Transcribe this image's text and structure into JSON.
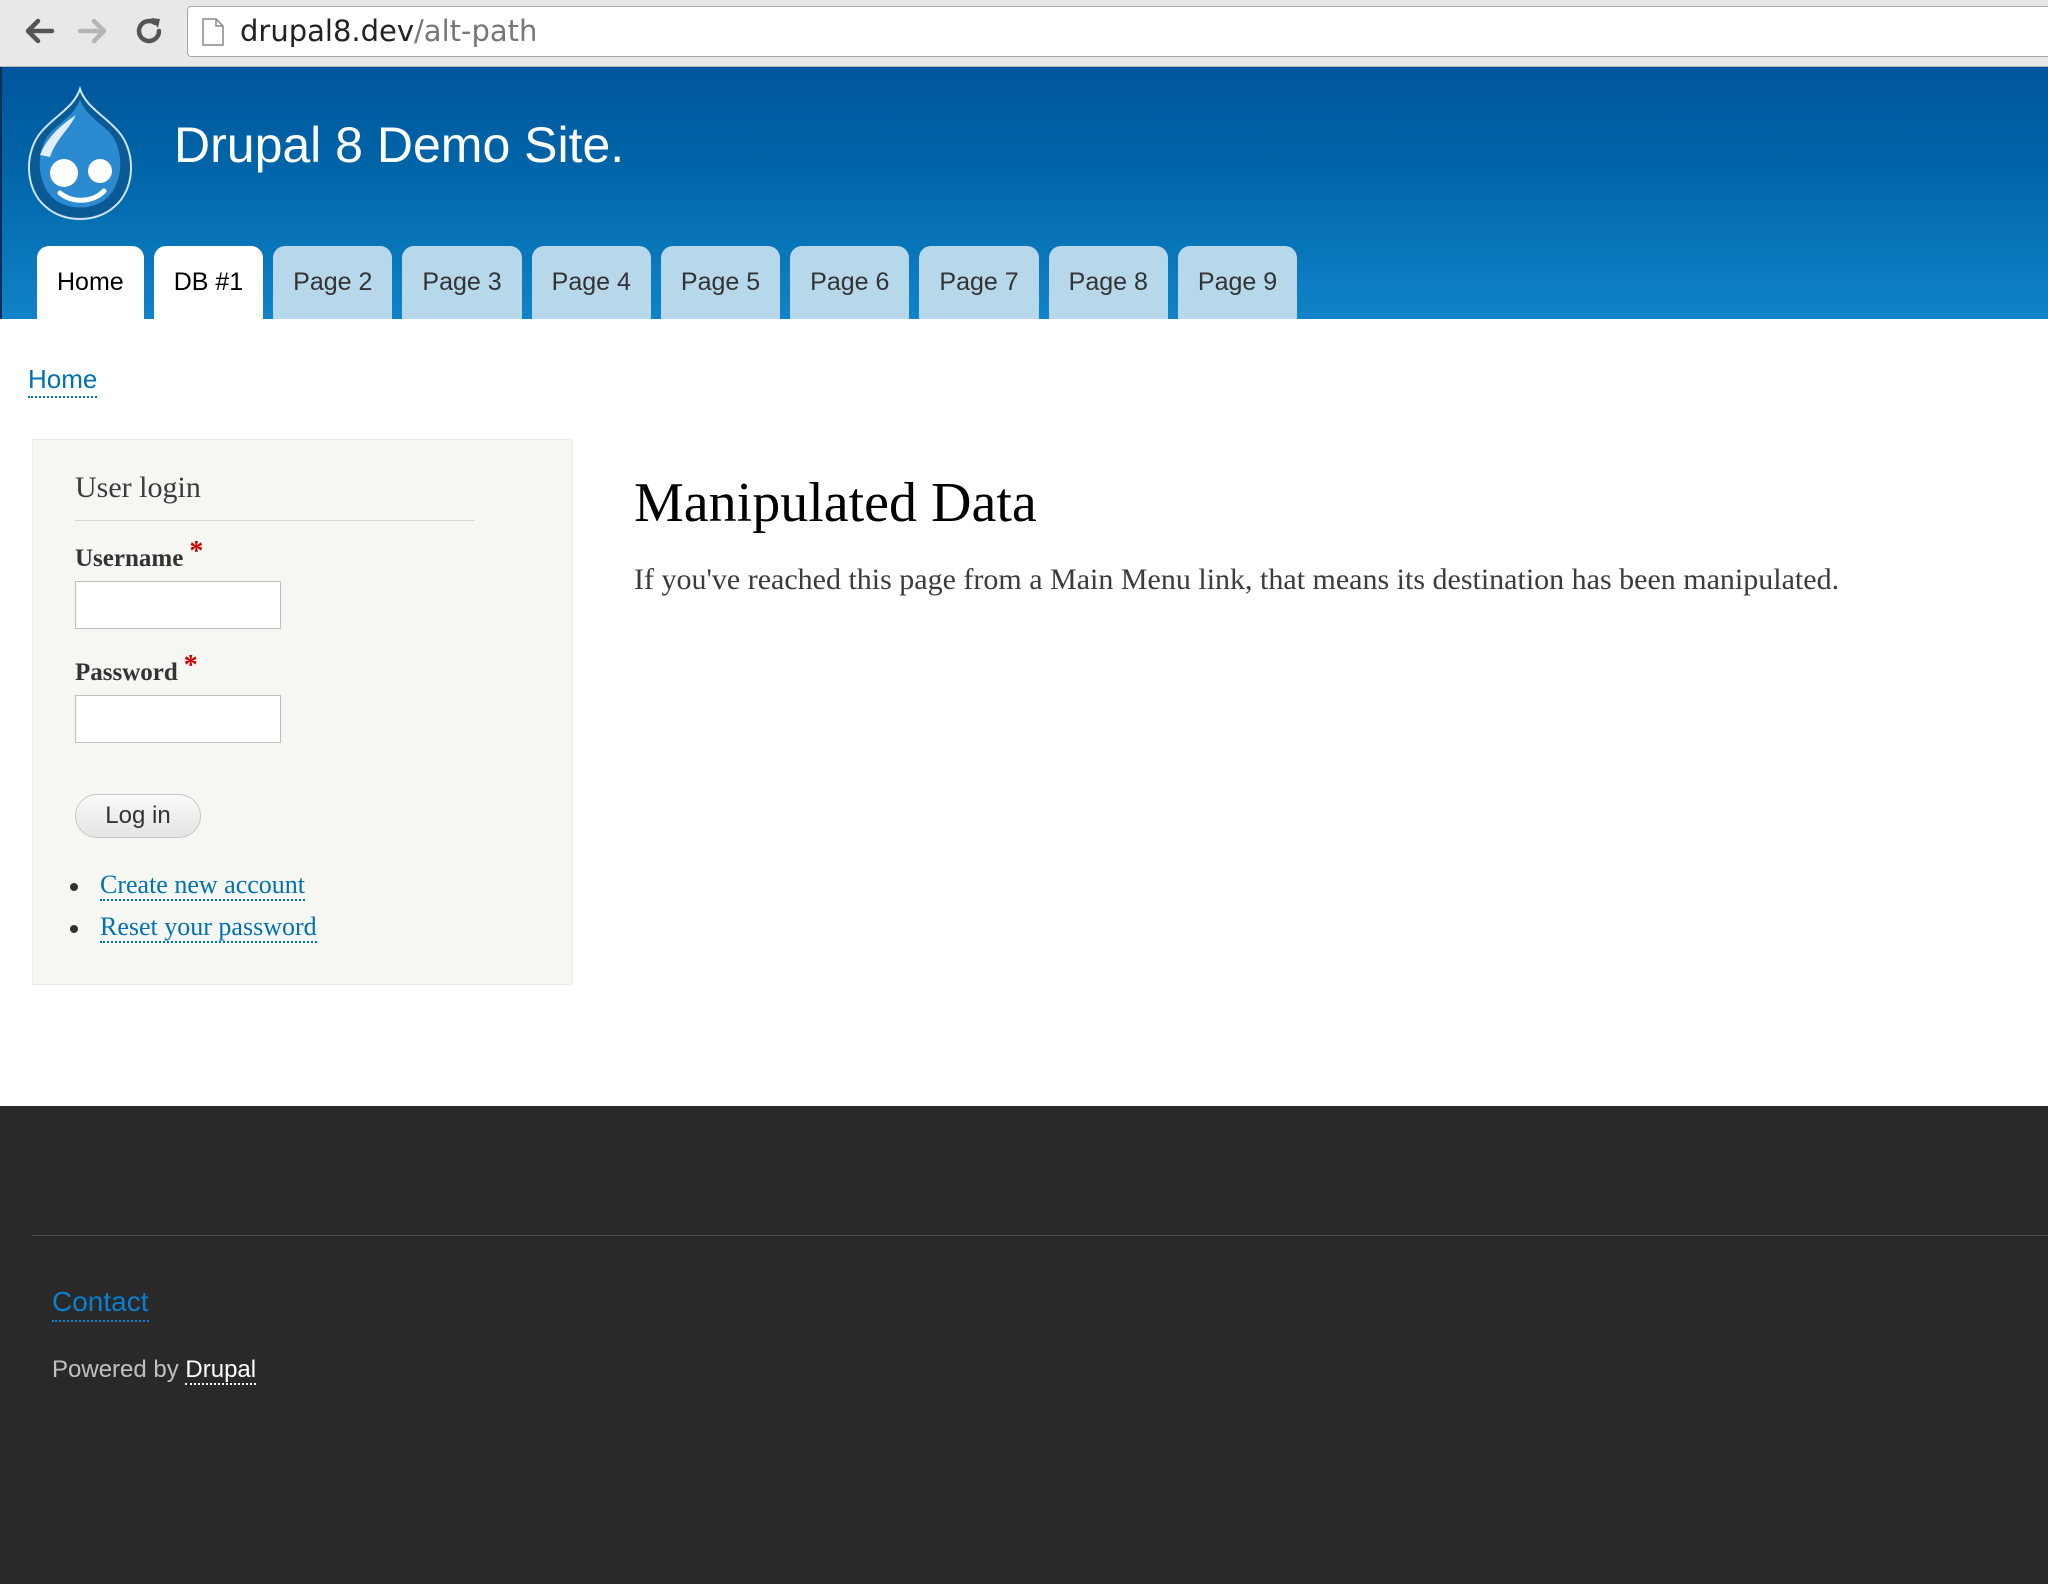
{
  "browser": {
    "url_host": "drupal8.dev",
    "url_path": "/alt-path"
  },
  "header": {
    "site_name": "Drupal 8 Demo Site.",
    "tabs": [
      {
        "label": "Home"
      },
      {
        "label": "DB #1"
      },
      {
        "label": "Page 2"
      },
      {
        "label": "Page 3"
      },
      {
        "label": "Page 4"
      },
      {
        "label": "Page 5"
      },
      {
        "label": "Page 6"
      },
      {
        "label": "Page 7"
      },
      {
        "label": "Page 8"
      },
      {
        "label": "Page 9"
      }
    ]
  },
  "breadcrumb": {
    "label": "Home"
  },
  "login": {
    "title": "User login",
    "username_label": "Username",
    "password_label": "Password",
    "required_mark": "*",
    "button": "Log in",
    "links": [
      {
        "label": "Create new account"
      },
      {
        "label": "Reset your password"
      }
    ]
  },
  "content": {
    "title": "Manipulated Data",
    "body": "If you've reached this page from a Main Menu link, that means its destination has been manipulated."
  },
  "footer": {
    "contact": "Contact",
    "powered_prefix": "Powered by ",
    "powered_link": "Drupal"
  },
  "icons": {
    "back": "arrow-left-icon",
    "forward": "arrow-right-icon",
    "reload": "reload-icon",
    "page": "page-icon",
    "logo": "drupal-drop-logo"
  },
  "colors": {
    "header_blue": "#0065a8",
    "tab_inactive": "#b7d7eb",
    "link": "#0071b3",
    "footer_bg": "#292929"
  }
}
